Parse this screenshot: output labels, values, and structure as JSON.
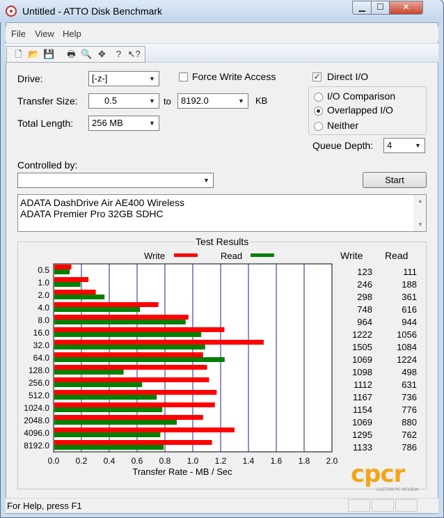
{
  "window": {
    "title": "Untitled - ATTO Disk Benchmark"
  },
  "menu": {
    "items": [
      "File",
      "View",
      "Help"
    ]
  },
  "toolbar": {
    "buttons": [
      {
        "name": "new-icon",
        "glyph": "🗋"
      },
      {
        "name": "open-icon",
        "glyph": "📂"
      },
      {
        "name": "save-icon",
        "glyph": "💾"
      },
      {
        "name": "print-icon",
        "glyph": "🖶"
      },
      {
        "name": "print-preview-icon",
        "glyph": "🔍"
      },
      {
        "name": "move-icon",
        "glyph": "✥"
      },
      {
        "name": "help-icon",
        "glyph": "?"
      },
      {
        "name": "context-help-icon",
        "glyph": "↖?"
      }
    ]
  },
  "form": {
    "drive_label": "Drive:",
    "drive_value": "[-z-]",
    "force_write_label": "Force Write Access",
    "force_write_checked": false,
    "transfer_size_label": "Transfer Size:",
    "transfer_from": "0.5",
    "to_label": "to",
    "transfer_to": "8192.0",
    "kb_label": "KB",
    "total_length_label": "Total Length:",
    "total_length_value": "256 MB",
    "direct_io_label": "Direct I/O",
    "direct_io_checked": true,
    "io_comparison_label": "I/O Comparison",
    "overlapped_io_label": "Overlapped I/O",
    "neither_label": "Neither",
    "io_mode_selected": "Overlapped I/O",
    "queue_depth_label": "Queue Depth:",
    "queue_depth_value": "4",
    "controlled_by_label": "Controlled by:",
    "controlled_by_value": "",
    "start_label": "Start",
    "devices": [
      "ADATA DashDrive Air AE400 Wireless",
      "ADATA Premier Pro 32GB SDHC"
    ]
  },
  "results": {
    "title": "Test Results",
    "write_header": "Write",
    "read_header": "Read",
    "legend_write": "Write",
    "legend_read": "Read",
    "write_color": "#ff0000",
    "read_color": "#008000"
  },
  "chart_data": {
    "type": "bar",
    "orientation": "horizontal",
    "categories": [
      "0.5",
      "1.0",
      "2.0",
      "4.0",
      "8.0",
      "16.0",
      "32.0",
      "64.0",
      "128.0",
      "256.0",
      "512.0",
      "1024.0",
      "2048.0",
      "4096.0",
      "8192.0"
    ],
    "series": [
      {
        "name": "Write",
        "values": [
          123,
          246,
          298,
          748,
          964,
          1222,
          1505,
          1069,
          1098,
          1112,
          1167,
          1154,
          1069,
          1295,
          1133
        ]
      },
      {
        "name": "Read",
        "values": [
          111,
          188,
          361,
          616,
          944,
          1056,
          1084,
          1224,
          498,
          631,
          736,
          776,
          880,
          762,
          786
        ]
      }
    ],
    "xlabel": "Transfer Rate - MB / Sec",
    "x_ticks": [
      "0.0",
      "0.2",
      "0.4",
      "0.6",
      "0.8",
      "1.0",
      "1.2",
      "1.4",
      "1.6",
      "1.8",
      "2.0"
    ],
    "xlim": [
      0,
      2000
    ],
    "grid": true
  },
  "watermark": {
    "text": "cpcr",
    "subtext": "CUSTOM PC REVIEW"
  },
  "status": {
    "text": "For Help, press F1"
  }
}
